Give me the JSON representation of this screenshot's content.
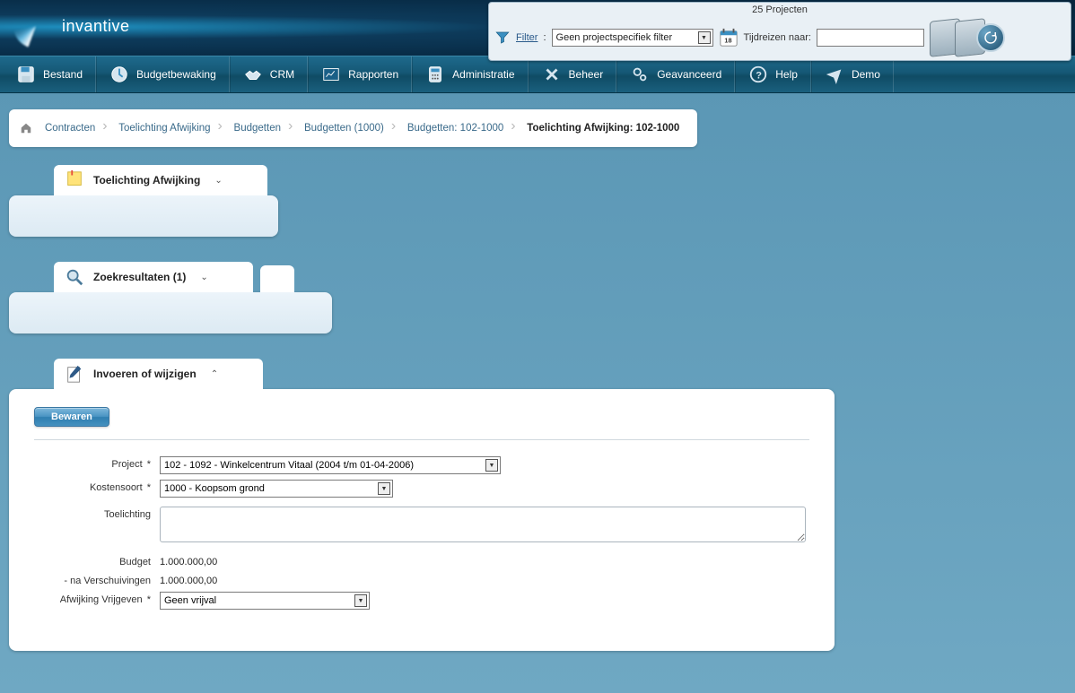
{
  "header": {
    "brand": "invantive",
    "projects_count_label": "25 Projecten",
    "filter_label": "Filter",
    "filter_colon": ":",
    "filter_value": "Geen projectspecifiek filter",
    "tijdreizen_label": "Tijdreizen naar:",
    "tijdreizen_value": ""
  },
  "menu": {
    "items": [
      {
        "label": "Bestand"
      },
      {
        "label": "Budgetbewaking"
      },
      {
        "label": "CRM"
      },
      {
        "label": "Rapporten"
      },
      {
        "label": "Administratie"
      },
      {
        "label": "Beheer"
      },
      {
        "label": "Geavanceerd"
      },
      {
        "label": "Help"
      },
      {
        "label": "Demo"
      }
    ]
  },
  "breadcrumb": {
    "items": [
      {
        "label": "Contracten"
      },
      {
        "label": "Toelichting Afwijking"
      },
      {
        "label": "Budgetten"
      },
      {
        "label": "Budgetten (1000)"
      },
      {
        "label": "Budgetten: 102-1000"
      },
      {
        "label": "Toelichting Afwijking: 102-1000"
      }
    ]
  },
  "panels": {
    "afwijking": {
      "title": "Toelichting Afwijking"
    },
    "zoekresultaten": {
      "title": "Zoekresultaten (1)"
    },
    "invoeren": {
      "title": "Invoeren of wijzigen"
    }
  },
  "form": {
    "save_label": "Bewaren",
    "project_label": "Project",
    "project_value": "102 - 1092 - Winkelcentrum Vitaal (2004 t/m 01-04-2006)",
    "kostensoort_label": "Kostensoort",
    "kostensoort_value": "1000 - Koopsom grond",
    "toelichting_label": "Toelichting",
    "toelichting_value": "",
    "budget_label": "Budget",
    "budget_value": "1.000.000,00",
    "na_verschuivingen_label": "- na Verschuivingen",
    "na_verschuivingen_value": "1.000.000,00",
    "afwijking_vrijgeven_label": "Afwijking Vrijgeven",
    "afwijking_vrijgeven_value": "Geen vrijval",
    "required_marker": "*"
  }
}
